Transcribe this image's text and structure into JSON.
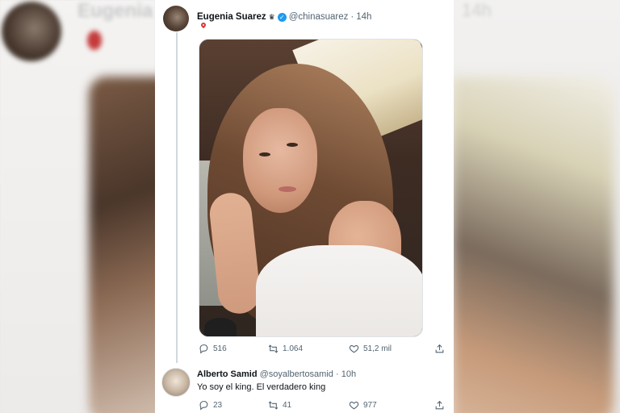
{
  "background": {
    "left_name": "Eugenia",
    "right_time": "14h"
  },
  "tweet": {
    "author_name": "Eugenia Suarez",
    "crown_glyph": "♛",
    "verified_glyph": "✓",
    "handle": "@chinasuarez",
    "separator": "·",
    "time": "14h",
    "location_icon": "location-pin-icon",
    "stats": {
      "replies": "516",
      "retweets": "1.064",
      "likes": "51,2 mil"
    }
  },
  "reply": {
    "author_name": "Alberto Samid",
    "handle": "@soyalbertosamid",
    "separator": "·",
    "time": "10h",
    "text": "Yo soy el king. El verdadero king",
    "stats": {
      "replies": "23",
      "retweets": "41",
      "likes": "977"
    }
  },
  "colors": {
    "verified": "#1d9bf0",
    "pin": "#d93838",
    "secondary_text": "#536471",
    "thread_line": "#cfd9de"
  }
}
